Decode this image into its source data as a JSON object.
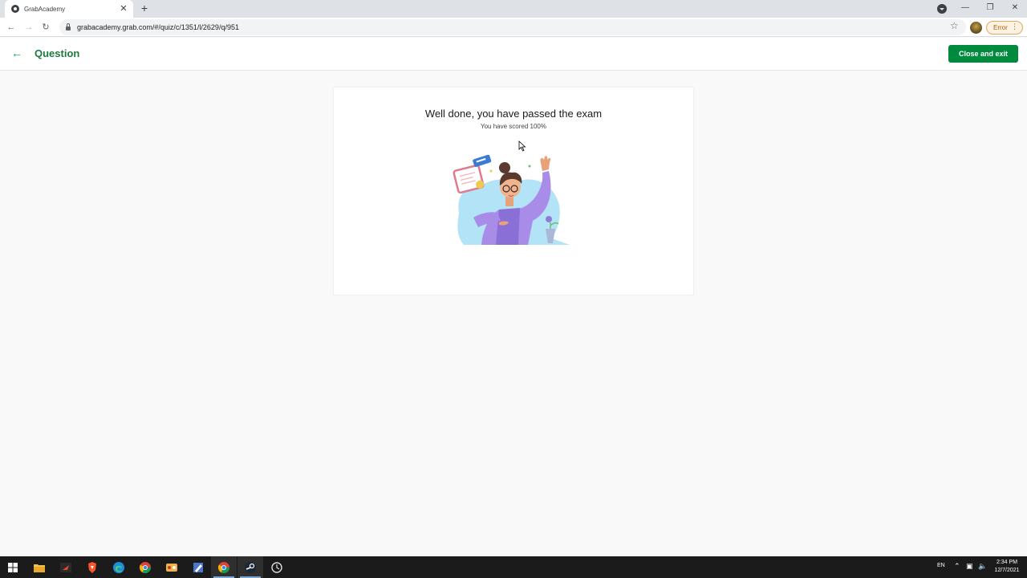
{
  "browser": {
    "tab_title": "GrabAcademy",
    "tab_close": "✕",
    "new_tab": "+",
    "url": "grabacademy.grab.com/#/quiz/c/1351/l/2629/q/951",
    "error_label": "Error",
    "error_menu": "⋮",
    "window_minimize": "—",
    "window_restore": "❐",
    "window_close": "✕"
  },
  "header": {
    "title": "Question",
    "close_button": "Close and exit",
    "accent_color": "#008a3e"
  },
  "result": {
    "heading": "Well done, you have passed the exam",
    "score_text": "You have scored 100%"
  },
  "taskbar": {
    "language": "EN",
    "time": "2:34 PM",
    "date": "12/7/2021",
    "apps": [
      "windows-start-icon",
      "file-explorer-icon",
      "app-red-icon",
      "brave-icon",
      "edge-icon",
      "chrome-icon",
      "game-app-icon",
      "notepad-app-icon",
      "chrome-icon",
      "steam-icon",
      "clock-app-icon"
    ]
  }
}
